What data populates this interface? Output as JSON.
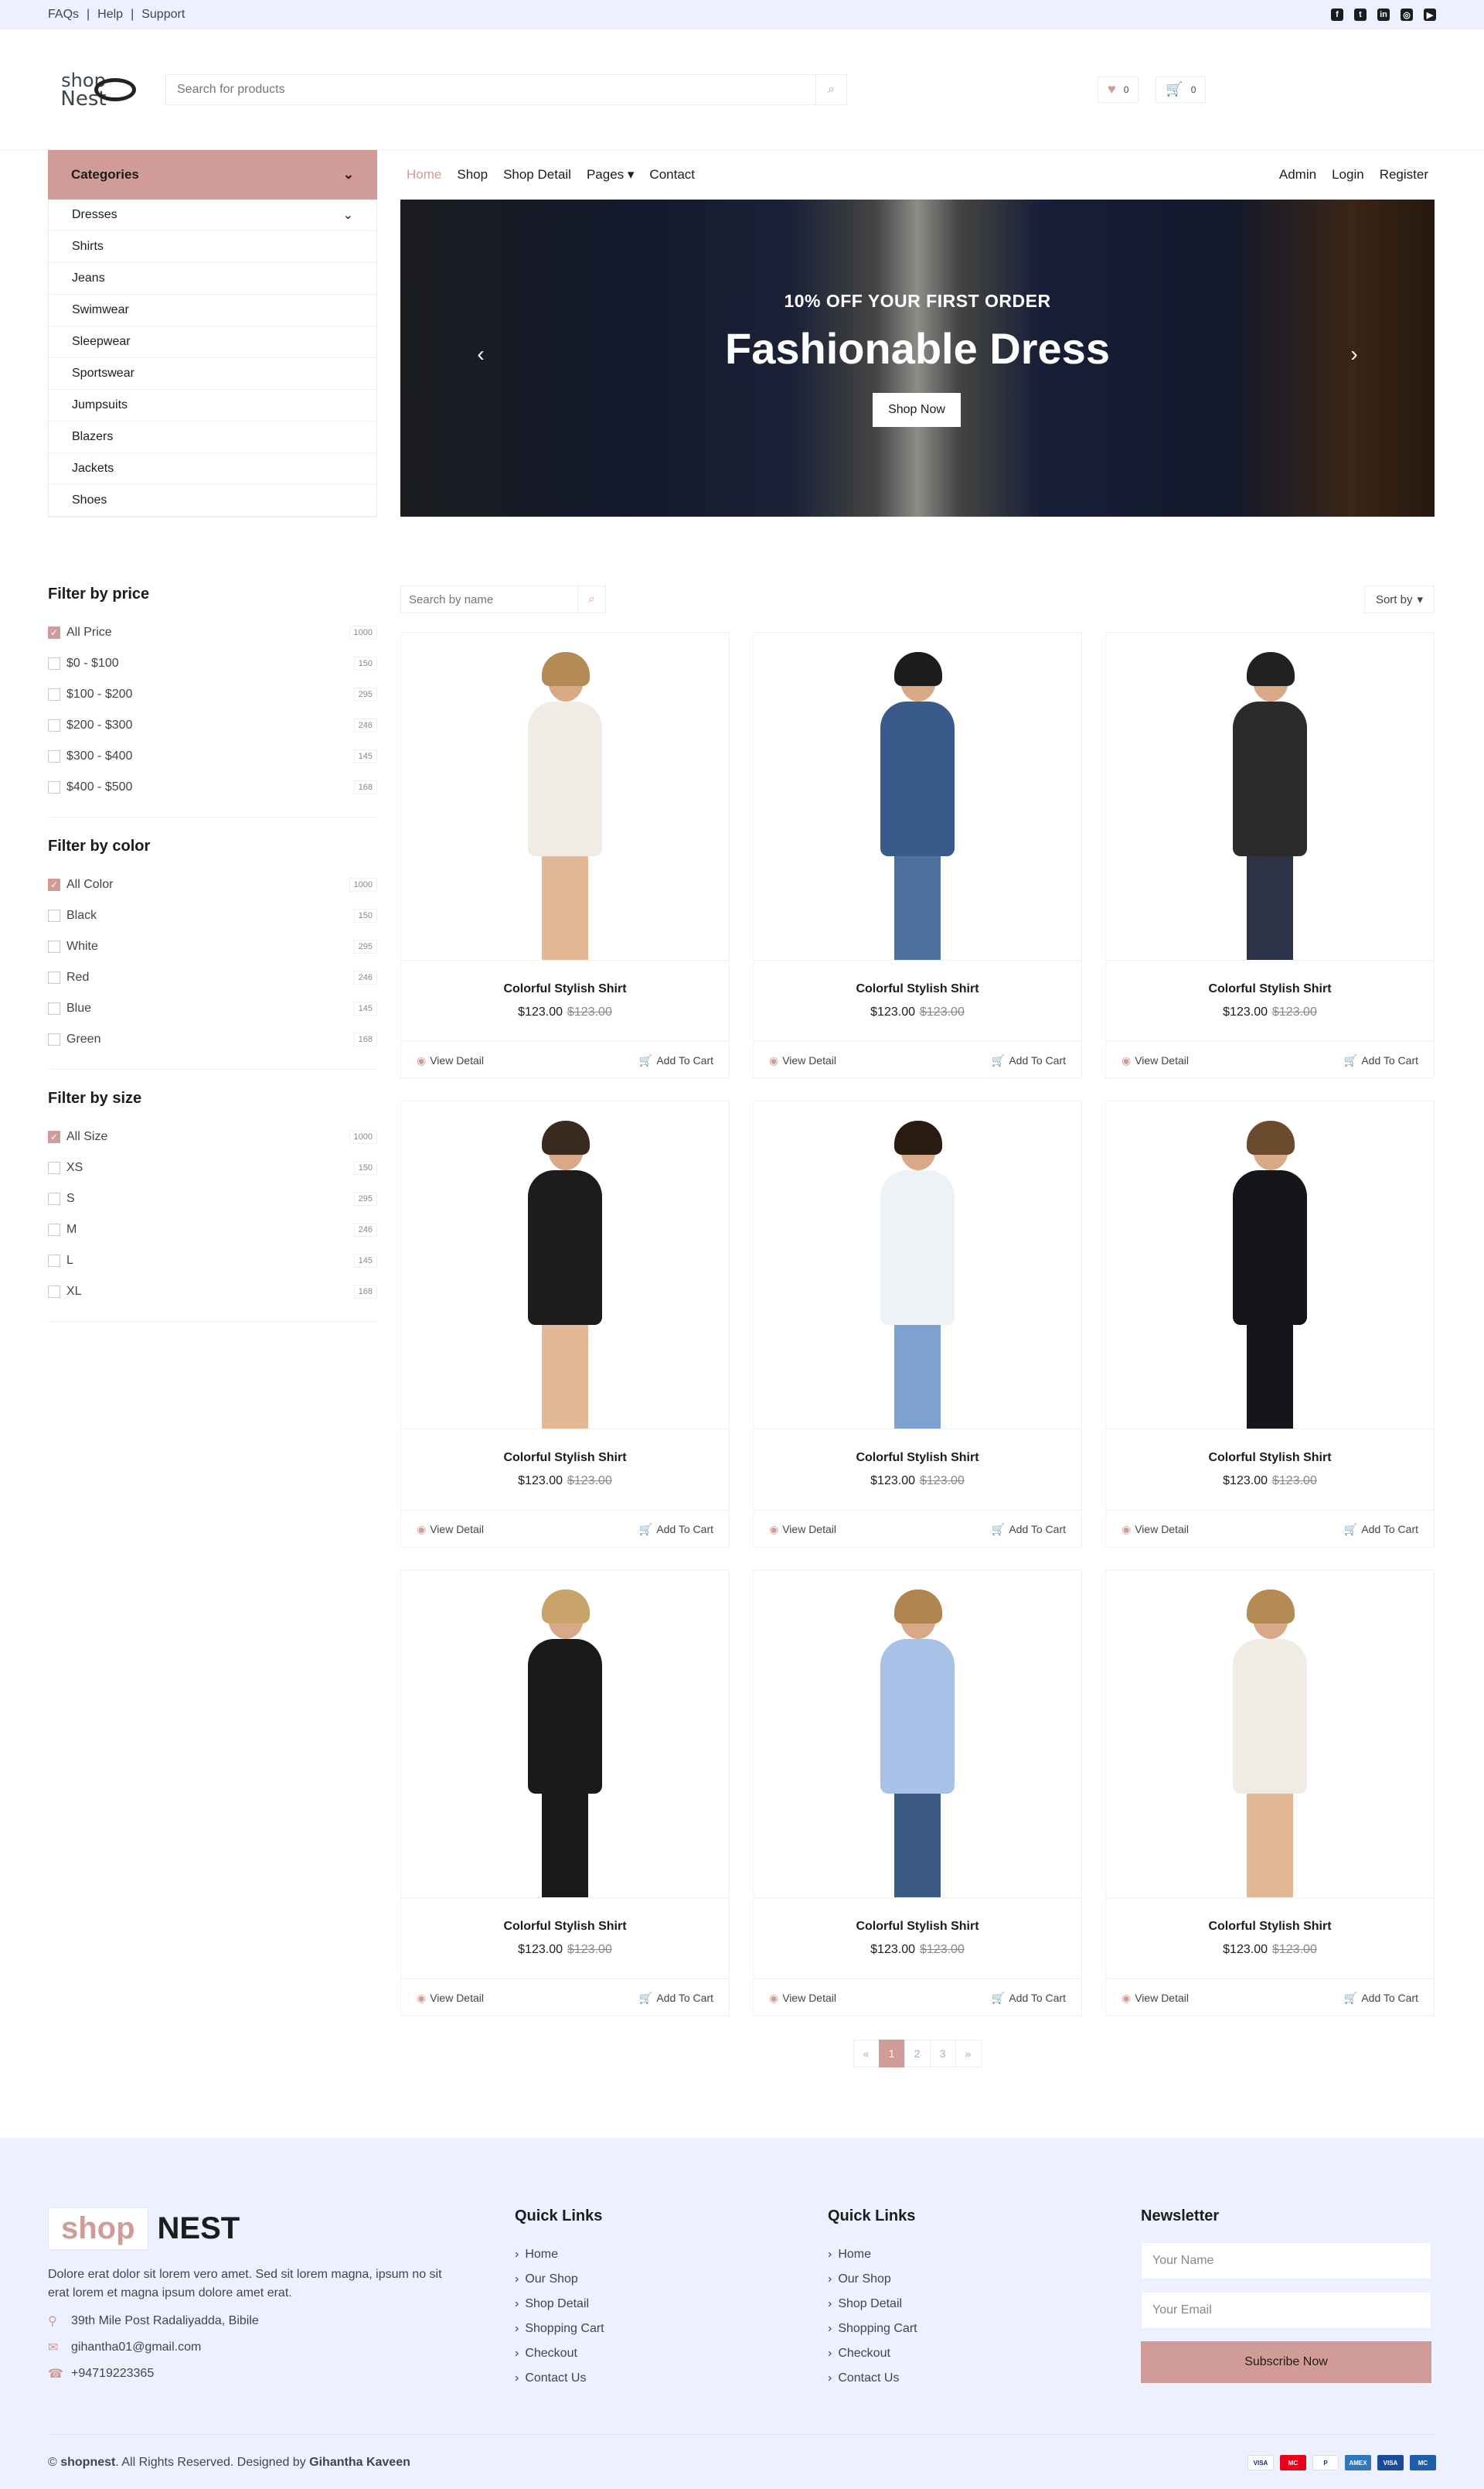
{
  "topbar": {
    "links": [
      "FAQs",
      "Help",
      "Support"
    ]
  },
  "logo": {
    "line1": "shop",
    "line2": "Nest"
  },
  "search": {
    "placeholder": "Search for products"
  },
  "header_icons": {
    "wishlist_count": "0",
    "cart_count": "0"
  },
  "categories": {
    "title": "Categories",
    "items": [
      "Dresses",
      "Shirts",
      "Jeans",
      "Swimwear",
      "Sleepwear",
      "Sportswear",
      "Jumpsuits",
      "Blazers",
      "Jackets",
      "Shoes"
    ]
  },
  "nav": {
    "left": [
      "Home",
      "Shop",
      "Shop Detail",
      "Pages",
      "Contact"
    ],
    "right": [
      "Admin",
      "Login",
      "Register"
    ]
  },
  "hero": {
    "subtitle": "10% OFF YOUR FIRST ORDER",
    "title": "Fashionable Dress",
    "button": "Shop Now"
  },
  "filters": [
    {
      "title": "Filter by price",
      "options": [
        [
          "All Price",
          "1000"
        ],
        [
          "$0 - $100",
          "150"
        ],
        [
          "$100 - $200",
          "295"
        ],
        [
          "$200 - $300",
          "246"
        ],
        [
          "$300 - $400",
          "145"
        ],
        [
          "$400 - $500",
          "168"
        ]
      ]
    },
    {
      "title": "Filter by color",
      "options": [
        [
          "All Color",
          "1000"
        ],
        [
          "Black",
          "150"
        ],
        [
          "White",
          "295"
        ],
        [
          "Red",
          "246"
        ],
        [
          "Blue",
          "145"
        ],
        [
          "Green",
          "168"
        ]
      ]
    },
    {
      "title": "Filter by size",
      "options": [
        [
          "All Size",
          "1000"
        ],
        [
          "XS",
          "150"
        ],
        [
          "S",
          "295"
        ],
        [
          "M",
          "246"
        ],
        [
          "L",
          "145"
        ],
        [
          "XL",
          "168"
        ]
      ]
    }
  ],
  "products_toolbar": {
    "search_placeholder": "Search by name",
    "sort_label": "Sort by"
  },
  "product_actions": {
    "view": "View Detail",
    "cart": "Add To Cart"
  },
  "products": [
    {
      "name": "Colorful Stylish Shirt",
      "price": "$123.00",
      "old_price": "$123.00",
      "style": "woman-dress"
    },
    {
      "name": "Colorful Stylish Shirt",
      "price": "$123.00",
      "old_price": "$123.00",
      "style": "boy-denim"
    },
    {
      "name": "Colorful Stylish Shirt",
      "price": "$123.00",
      "old_price": "$123.00",
      "style": "man-jacket"
    },
    {
      "name": "Colorful Stylish Shirt",
      "price": "$123.00",
      "old_price": "$123.00",
      "style": "woman-black"
    },
    {
      "name": "Colorful Stylish Shirt",
      "price": "$123.00",
      "old_price": "$123.00",
      "style": "girl-tshirt"
    },
    {
      "name": "Colorful Stylish Shirt",
      "price": "$123.00",
      "old_price": "$123.00",
      "style": "man-suit"
    },
    {
      "name": "Colorful Stylish Shirt",
      "price": "$123.00",
      "old_price": "$123.00",
      "style": "woman-coat"
    },
    {
      "name": "Colorful Stylish Shirt",
      "price": "$123.00",
      "old_price": "$123.00",
      "style": "boy-shirt"
    },
    {
      "name": "Colorful Stylish Shirt",
      "price": "$123.00",
      "old_price": "$123.00",
      "style": "woman-dress"
    }
  ],
  "pagination": [
    "«",
    "1",
    "2",
    "3",
    "»"
  ],
  "footer": {
    "logo_a": "shop",
    "logo_b": "NEST",
    "desc": "Dolore erat dolor sit lorem vero amet. Sed sit lorem magna, ipsum no sit erat lorem et magna ipsum dolore amet erat.",
    "address": "39th Mile Post Radaliyadda, Bibile",
    "email": "gihantha01@gmail.com",
    "phone": "+94719223365",
    "quick_links_title": "Quick Links",
    "quick_links": [
      "Home",
      "Our Shop",
      "Shop Detail",
      "Shopping Cart",
      "Checkout",
      "Contact Us"
    ],
    "newsletter_title": "Newsletter",
    "name_placeholder": "Your Name",
    "email_placeholder": "Your Email",
    "subscribe": "Subscribe Now",
    "copyright_prefix": "© ",
    "brand": "shopnest",
    "copyright_mid": ". All Rights Reserved. Designed by ",
    "designer": "Gihantha Kaveen"
  },
  "colors": {
    "accent": "#d19c97",
    "light_bg": "#edf1ff",
    "dark": "#1c1c1c"
  }
}
